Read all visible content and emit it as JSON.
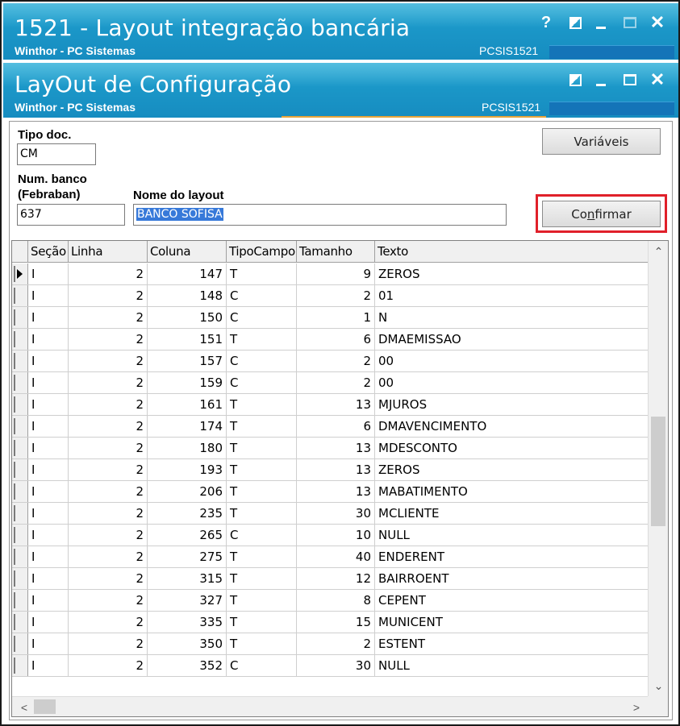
{
  "window1": {
    "title": "1521 - Layout integração bancária",
    "subtitle": "Winthor - PC Sistemas",
    "code": "PCSIS1521",
    "help_glyph": "?",
    "close_glyph": "✕"
  },
  "window2": {
    "title": "LayOut de Configuração",
    "subtitle": "Winthor - PC Sistemas",
    "code": "PCSIS1521",
    "close_glyph": "✕"
  },
  "form": {
    "tipo_doc_label": "Tipo doc.",
    "tipo_doc_value": "CM",
    "num_banco_label_1": "Num. banco",
    "num_banco_label_2": "(Febraban)",
    "num_banco_value": "637",
    "nome_layout_label": "Nome do layout",
    "nome_layout_value": "BANCO SOFISA",
    "variaveis_label": "Variáveis",
    "confirmar_pre": "Co",
    "confirmar_u": "n",
    "confirmar_post": "firmar"
  },
  "grid": {
    "columns": [
      "Seção",
      "Linha",
      "Coluna",
      "TipoCampo",
      "Tamanho",
      "Texto"
    ],
    "rows": [
      {
        "secao": "I",
        "linha": "2",
        "coluna": "147",
        "tipo": "T",
        "tamanho": "9",
        "texto": "ZEROS"
      },
      {
        "secao": "I",
        "linha": "2",
        "coluna": "148",
        "tipo": "C",
        "tamanho": "2",
        "texto": "01"
      },
      {
        "secao": "I",
        "linha": "2",
        "coluna": "150",
        "tipo": "C",
        "tamanho": "1",
        "texto": "N"
      },
      {
        "secao": "I",
        "linha": "2",
        "coluna": "151",
        "tipo": "T",
        "tamanho": "6",
        "texto": "DMAEMISSAO"
      },
      {
        "secao": "I",
        "linha": "2",
        "coluna": "157",
        "tipo": "C",
        "tamanho": "2",
        "texto": "00"
      },
      {
        "secao": "I",
        "linha": "2",
        "coluna": "159",
        "tipo": "C",
        "tamanho": "2",
        "texto": "00"
      },
      {
        "secao": "I",
        "linha": "2",
        "coluna": "161",
        "tipo": "T",
        "tamanho": "13",
        "texto": "MJUROS"
      },
      {
        "secao": "I",
        "linha": "2",
        "coluna": "174",
        "tipo": "T",
        "tamanho": "6",
        "texto": "DMAVENCIMENTO"
      },
      {
        "secao": "I",
        "linha": "2",
        "coluna": "180",
        "tipo": "T",
        "tamanho": "13",
        "texto": "MDESCONTO"
      },
      {
        "secao": "I",
        "linha": "2",
        "coluna": "193",
        "tipo": "T",
        "tamanho": "13",
        "texto": "ZEROS"
      },
      {
        "secao": "I",
        "linha": "2",
        "coluna": "206",
        "tipo": "T",
        "tamanho": "13",
        "texto": "MABATIMENTO"
      },
      {
        "secao": "I",
        "linha": "2",
        "coluna": "235",
        "tipo": "T",
        "tamanho": "30",
        "texto": "MCLIENTE"
      },
      {
        "secao": "I",
        "linha": "2",
        "coluna": "265",
        "tipo": "C",
        "tamanho": "10",
        "texto": "NULL"
      },
      {
        "secao": "I",
        "linha": "2",
        "coluna": "275",
        "tipo": "T",
        "tamanho": "40",
        "texto": "ENDERENT"
      },
      {
        "secao": "I",
        "linha": "2",
        "coluna": "315",
        "tipo": "T",
        "tamanho": "12",
        "texto": "BAIRROENT"
      },
      {
        "secao": "I",
        "linha": "2",
        "coluna": "327",
        "tipo": "T",
        "tamanho": "8",
        "texto": "CEPENT"
      },
      {
        "secao": "I",
        "linha": "2",
        "coluna": "335",
        "tipo": "T",
        "tamanho": "15",
        "texto": "MUNICENT"
      },
      {
        "secao": "I",
        "linha": "2",
        "coluna": "350",
        "tipo": "T",
        "tamanho": "2",
        "texto": "ESTENT"
      },
      {
        "secao": "I",
        "linha": "2",
        "coluna": "352",
        "tipo": "C",
        "tamanho": "30",
        "texto": "NULL"
      }
    ]
  },
  "colors": {
    "titlebar": "#1b97c8",
    "highlight_box": "#e0202a",
    "selection": "#3779d9"
  },
  "icons": {
    "up": "⌃",
    "down": "⌄",
    "left": "<",
    "right": ">"
  }
}
